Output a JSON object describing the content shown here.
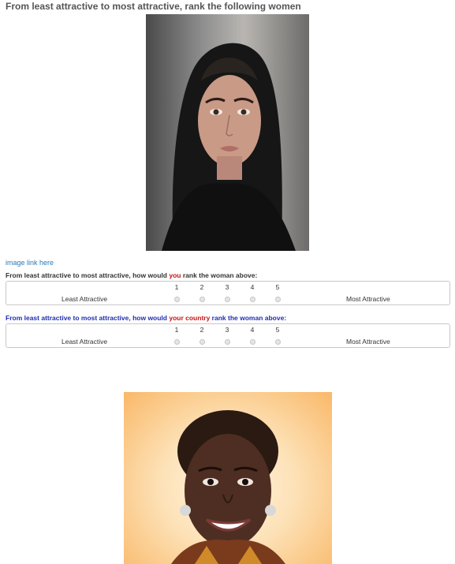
{
  "heading": "From least attractive to most attractive, rank the following women",
  "images": [
    {
      "alt": "Portrait of a woman wearing a dark headscarf"
    },
    {
      "alt": "Portrait of a smiling woman with short curly hair"
    }
  ],
  "image_link_label": "image link here",
  "questions": [
    {
      "prefix": "From least attractive to most attractive, how would ",
      "accent": "you",
      "suffix": " rank the woman above:",
      "scale": {
        "left_label": "Least Attractive",
        "right_label": "Most Attractive",
        "options": [
          "1",
          "2",
          "3",
          "4",
          "5"
        ]
      }
    },
    {
      "prefix": "From least attractive to most attractive, how would ",
      "accent": "your country",
      "suffix": " rank the woman above:",
      "scale": {
        "left_label": "Least Attractive",
        "right_label": "Most Attractive",
        "options": [
          "1",
          "2",
          "3",
          "4",
          "5"
        ]
      }
    }
  ],
  "colors": {
    "heading": "#555555",
    "link": "#2a7ab8",
    "question_2_text": "#1f2db3",
    "accent": "#cc1111",
    "border": "#c8c8c8"
  }
}
